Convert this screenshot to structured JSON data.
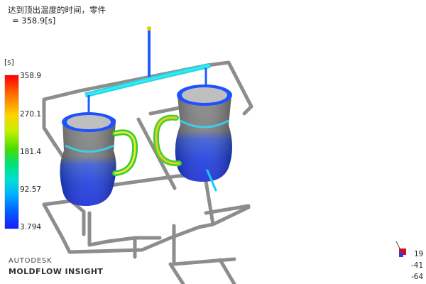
{
  "plot": {
    "title_line1": "达到顶出温度的时间，零件",
    "title_line2": "= 358.9[s]"
  },
  "legend": {
    "unit": "[s]",
    "ticks": [
      "358.9",
      "270.1",
      "181.4",
      "92.57",
      "3.794"
    ],
    "colors": [
      "#ff0000",
      "#ffd200",
      "#4cdc00",
      "#00e0d0",
      "#1a1aff"
    ]
  },
  "branding": {
    "company": "AUTODESK",
    "product": "MOLDFLOW INSIGHT"
  },
  "orientation": {
    "values": [
      "19",
      "-41",
      "-64"
    ]
  }
}
